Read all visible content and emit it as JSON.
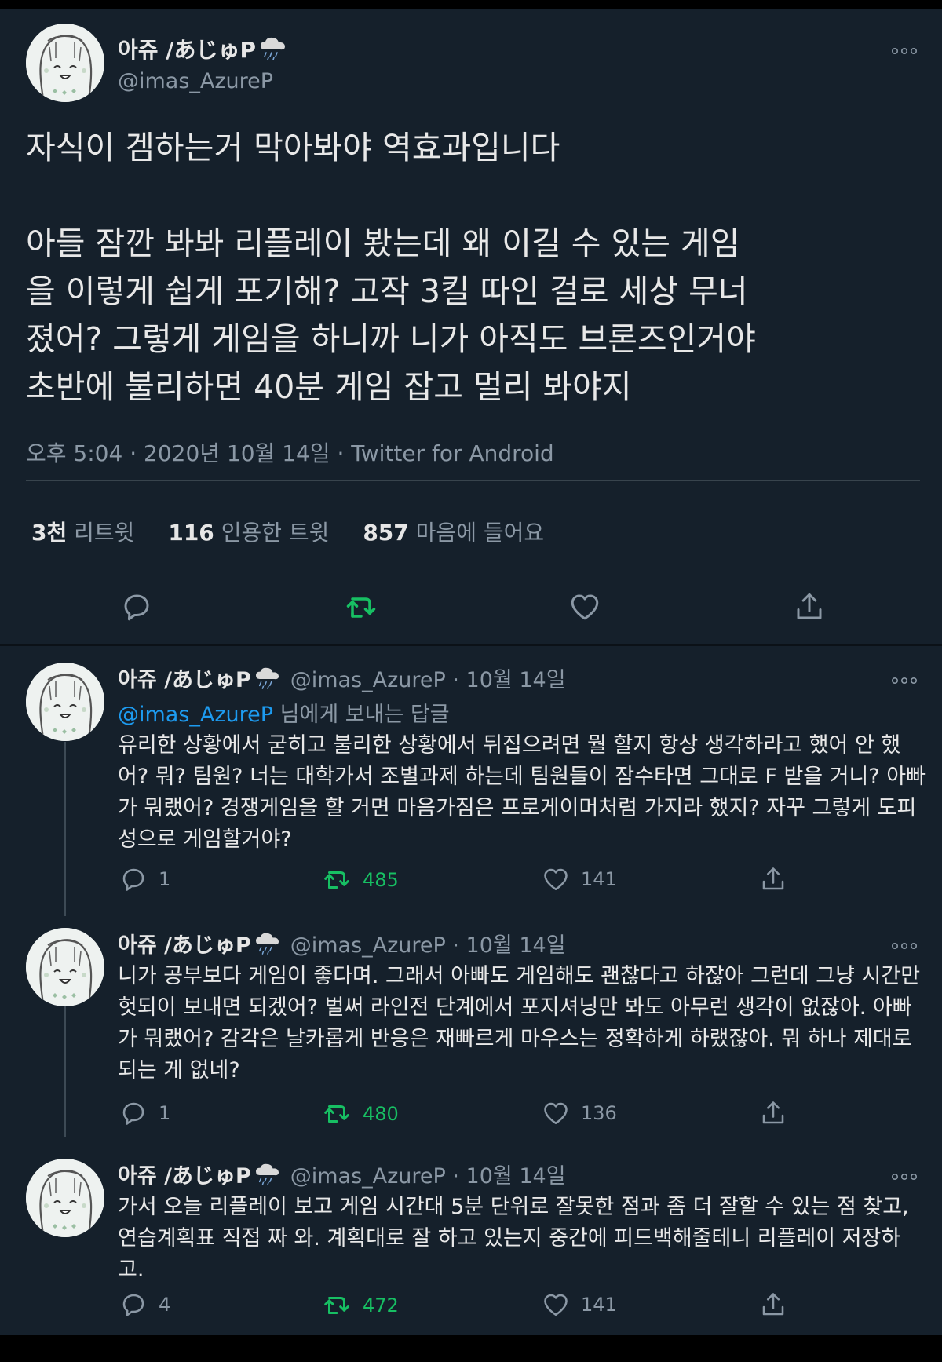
{
  "colors": {
    "background": "#15202b",
    "text": "#e8e8e8",
    "muted": "#8b98a5",
    "link": "#1d9bf0",
    "retweet_green": "#17bf63",
    "divider": "#38444d"
  },
  "main_tweet": {
    "display_name": "아쥬 /あじゅP",
    "handle": "@imas_AzureP",
    "text": "자식이 겜하는거 막아봐야 역효과입니다\n\n아들 잠깐 봐봐 리플레이 봤는데 왜 이길 수 있는 게임\n을 이렇게 쉽게 포기해? 고작 3킬 따인 걸로 세상 무너\n졌어? 그렇게 게임을 하니까 니가 아직도 브론즈인거야\n초반에 불리하면 40분 게임 잡고 멀리 봐야지",
    "timestamp": "오후 5:04 · 2020년 10월 14일 · Twitter for Android",
    "stats": {
      "retweets_value": "3천",
      "retweets_label": "리트윗",
      "quotes_value": "116",
      "quotes_label": "인용한 트윗",
      "likes_value": "857",
      "likes_label": "마음에 들어요"
    },
    "icons": [
      "reply-icon",
      "retweet-icon",
      "like-icon",
      "share-icon"
    ]
  },
  "replies": [
    {
      "display_name": "아쥬 /あじゅP",
      "handle_date": "@imas_AzureP · 10월 14일",
      "reply_to_handle": "@imas_AzureP",
      "reply_to_suffix": " 님에게 보내는 답글",
      "text": "유리한 상황에서 굳히고 불리한 상황에서 뒤집으려면 뭘 할지 항상 생각하라고 했어 안 했어? 뭐? 팀원? 너는 대학가서 조별과제 하는데 팀원들이 잠수타면 그대로 F 받을 거니? 아빠가 뭐랬어? 경쟁게임을 할 거면 마음가짐은 프로게이머처럼 가지라 했지? 자꾸 그렇게 도피성으로 게임할거야?",
      "reply_count": "1",
      "retweet_count": "485",
      "like_count": "141"
    },
    {
      "display_name": "아쥬 /あじゅP",
      "handle_date": "@imas_AzureP · 10월 14일",
      "text": "니가 공부보다 게임이 좋다며. 그래서 아빠도 게임해도 괜찮다고 하잖아 그런데 그냥 시간만 헛되이 보내면 되겠어? 벌써 라인전 단계에서 포지셔닝만 봐도 아무런 생각이 없잖아. 아빠가 뭐랬어? 감각은 날카롭게 반응은 재빠르게 마우스는 정확하게 하랬잖아. 뭐 하나 제대로 되는 게 없네?",
      "reply_count": "1",
      "retweet_count": "480",
      "like_count": "136"
    },
    {
      "display_name": "아쥬 /あじゅP",
      "handle_date": "@imas_AzureP · 10월 14일",
      "text": "가서 오늘 리플레이 보고 게임 시간대 5분 단위로 잘못한 점과 좀 더 잘할 수 있는 점 찾고, 연습계획표 직접 짜 와. 계획대로 잘 하고 있는지 중간에 피드백해줄테니 리플레이 저장하고.",
      "reply_count": "4",
      "retweet_count": "472",
      "like_count": "141"
    }
  ]
}
